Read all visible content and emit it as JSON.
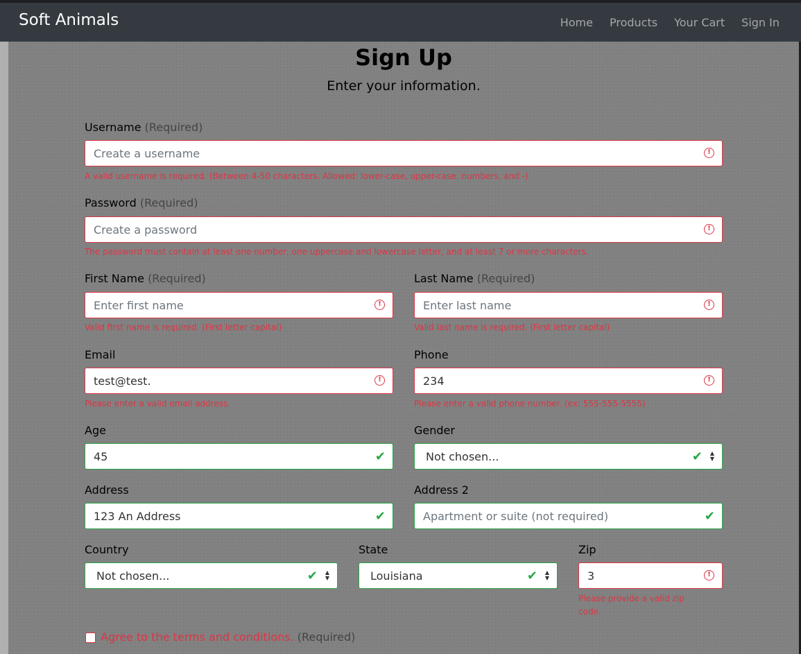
{
  "navbar": {
    "brand": "Soft Animals",
    "links": [
      "Home",
      "Products",
      "Your Cart",
      "Sign In"
    ]
  },
  "page": {
    "title": "Sign Up",
    "subtitle": "Enter your information."
  },
  "required_tag": "(Required)",
  "fields": {
    "username": {
      "label": "Username",
      "placeholder": "Create a username",
      "error": "A valid username is required. (Between 4-50 characters. Allowed: lower-case, upper-case, numbers, and -)"
    },
    "password": {
      "label": "Password",
      "placeholder": "Create a password",
      "error": "The password must contain at least one number, one uppercase and lowercase letter, and at least 7 or more characters."
    },
    "first_name": {
      "label": "First Name",
      "placeholder": "Enter first name",
      "error": "Valid first name is required. (First letter capital)"
    },
    "last_name": {
      "label": "Last Name",
      "placeholder": "Enter last name",
      "error": "Valid last name is required. (First letter capital)"
    },
    "email": {
      "label": "Email",
      "value": "test@test.",
      "error": "Please enter a valid email address."
    },
    "phone": {
      "label": "Phone",
      "value": "234",
      "error": "Please enter a valid phone number. (ex: 555-555-5555)"
    },
    "age": {
      "label": "Age",
      "value": "45"
    },
    "gender": {
      "label": "Gender",
      "value": "Not chosen..."
    },
    "address": {
      "label": "Address",
      "value": "123 An Address"
    },
    "address2": {
      "label": "Address 2",
      "placeholder": "Apartment or suite (not required)"
    },
    "country": {
      "label": "Country",
      "value": "Not chosen..."
    },
    "state": {
      "label": "State",
      "value": "Louisiana"
    },
    "zip": {
      "label": "Zip",
      "value": "3",
      "error_line1": "Please provide a valid zip",
      "error_line2": "code."
    }
  },
  "terms": {
    "label": "Agree to the terms and conditions.",
    "required": "(Required)"
  },
  "colors": {
    "navbar": "#343a40",
    "invalid": "#dc3545",
    "valid": "#28a745"
  }
}
